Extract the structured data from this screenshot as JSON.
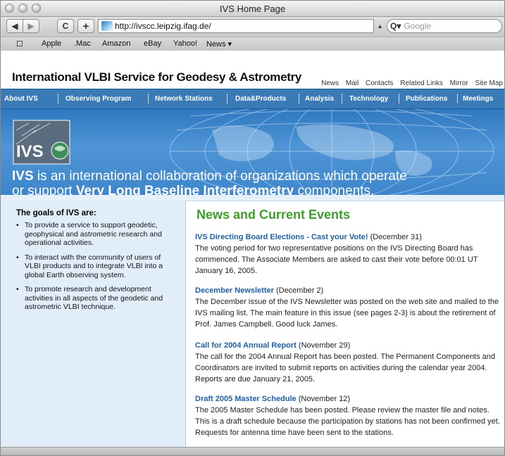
{
  "window": {
    "title": "IVS Home Page"
  },
  "toolbar": {
    "back": "◀",
    "forward": "▶",
    "reload": "C",
    "add": "+",
    "url": "http://ivscc.leipzig.ifag.de/",
    "search_placeholder": "Google"
  },
  "bookmarks": {
    "icon": "book-icon",
    "items": [
      "Apple",
      ".Mac",
      "Amazon",
      "eBay",
      "Yahoo!",
      "News ▾"
    ]
  },
  "page": {
    "top_links": [
      "News",
      "Mail",
      "Contacts",
      "Related Links",
      "Mirror",
      "Site Map"
    ],
    "site_title": "International VLBI Service for Geodesy & Astrometry",
    "nav": [
      "About IVS",
      "Observing Program",
      "Network Stations",
      "Data&Products",
      "Analysis",
      "Technology",
      "Publications",
      "Meetings"
    ],
    "banner": {
      "logo_text": "IVS",
      "line1_bold": "IVS",
      "line1_rest": " is an international collaboration of organizations which operate",
      "line2_pre": "or support ",
      "line2_bold": "Very Long Baseline Interferometry",
      "line2_post": " components."
    },
    "goals": {
      "title": "The goals of IVS are:",
      "items": [
        "To provide a service to support geodetic, geophysical and astrometric research and operational activities.",
        "To interact with the community of users of VLBI products and to integrate VLBI into a global Earth observing system.",
        "To promote research and development activities in all aspects of the geodetic and astrometric VLBI technique."
      ]
    },
    "news": {
      "heading": "News and Current Events",
      "items": [
        {
          "title": "IVS Directing Board Elections - Cast your Vote!",
          "date": "(December 31)",
          "body": "The voting period for two representative positions on the IVS Directing Board has commenced. The Associate Members are asked to cast their vote before 00:01 UT January 16, 2005."
        },
        {
          "title": "December Newsletter",
          "date": "(December 2)",
          "body": "The December issue of the IVS Newsletter was posted on the web site and mailed to the IVS mailing list. The main feature in this issue (see pages 2-3) is about the retirement of Prof. James Campbell. Good luck James."
        },
        {
          "title": "Call for 2004 Annual Report",
          "date": "(November 29)",
          "body": "The call for the 2004 Annual Report has been posted. The Permanent Components and Coordinators are invited to submit reports on activities during the calendar year 2004. Reports are due January 21, 2005."
        },
        {
          "title": "Draft 2005 Master Schedule",
          "date": "(November 12)",
          "body": "The 2005 Master Schedule has been posted. Please review the master file and notes. This is a draft schedule because the participation by stations has not been confirmed yet. Requests for antenna time have been sent to the stations."
        }
      ]
    }
  },
  "colors": {
    "nav_bg": "#3a7bb7",
    "news_heading": "#3e9e2c",
    "link": "#1f5fa6",
    "left_bg": "#e1eefa"
  }
}
